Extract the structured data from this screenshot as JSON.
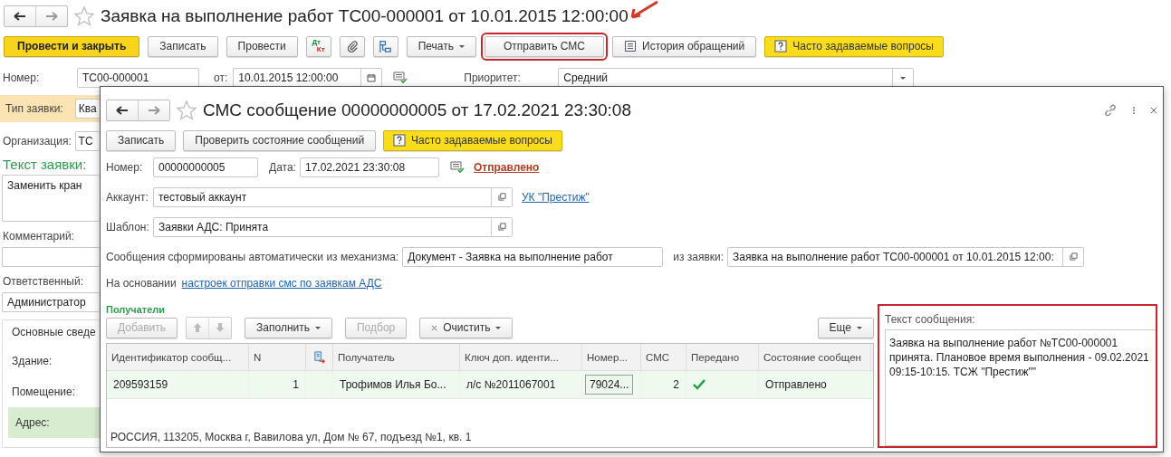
{
  "main_window": {
    "title": "Заявка на выполнение работ ТС00-000001 от 10.01.2015 12:00:00",
    "toolbar": [
      {
        "kind": "primary",
        "label": "Провести и закрыть",
        "highlighted": false
      },
      {
        "kind": "button",
        "label": "Записать",
        "highlighted": false
      },
      {
        "kind": "button",
        "label": "Провести",
        "highlighted": false
      },
      {
        "kind": "dtkt",
        "top": "Дт",
        "bottom": "Кт",
        "highlighted": false
      },
      {
        "kind": "clip",
        "highlighted": false
      },
      {
        "kind": "structure",
        "highlighted": false
      },
      {
        "kind": "dropdown",
        "label": "Печать",
        "highlighted": false
      },
      {
        "kind": "button",
        "label": "Отправить СМС",
        "highlighted": true
      },
      {
        "kind": "list",
        "label": "История обращений",
        "highlighted": false
      },
      {
        "kind": "help",
        "label": "Часто задаваемые вопросы",
        "highlighted": false
      }
    ],
    "number_label": "Номер:",
    "number": "ТС00-000001",
    "date_label": "от:",
    "date": "10.01.2015 12:00:00",
    "priority_label": "Приоритет:",
    "priority": "Средний",
    "type_label": "Тип заявки:",
    "type": "Ква",
    "org_label": "Организация:",
    "org": "ТС",
    "text_heading": "Текст заявки:",
    "text": "Заменить кран",
    "comment_label": "Комментарий:",
    "responsible_label": "Ответственный:",
    "responsible": "Администратор",
    "group_title": "Основные сведе",
    "building_label": "Здание:",
    "room_label": "Помещение:",
    "address_label": "Адрес:"
  },
  "sms_dialog": {
    "title": "СМС сообщение 00000000005 от 17.02.2021 23:30:08",
    "toolbar": [
      {
        "kind": "button",
        "label": "Записать"
      },
      {
        "kind": "button",
        "label": "Проверить состояние сообщений"
      },
      {
        "kind": "help",
        "label": "Часто задаваемые вопросы"
      }
    ],
    "number_label": "Номер:",
    "number": "00000000005",
    "date_label": "Дата:",
    "date": "17.02.2021 23:30:08",
    "status": "Отправлено",
    "account_label": "Аккаунт:",
    "account": "тестовый аккаунт",
    "account_link": "УК \"Престиж\"",
    "template_label": "Шаблон:",
    "template": "Заявки АДС: Принята",
    "source_label": "Сообщения сформированы автоматически из механизма:",
    "source": "Документ - Заявка на выполнение работ",
    "request_label": "из заявки:",
    "request": "Заявка на выполнение работ ТС00-000001 от 10.01.2015 12:00:",
    "basis_text": "На основании",
    "basis_link": "настроек отправки смс по заявкам АДС",
    "recipients_title": "Получатели",
    "recipients_toolbar": [
      {
        "kind": "button",
        "label": "Добавить",
        "disabled": true
      },
      {
        "kind": "arrows",
        "disabled": true
      },
      {
        "kind": "dropdown",
        "label": "Заполнить",
        "disabled": false
      },
      {
        "kind": "button",
        "label": "Подбор",
        "disabled": true
      },
      {
        "kind": "clear",
        "label": "Очистить",
        "disabled": false
      }
    ],
    "more_button": "Еще",
    "table": {
      "columns": [
        {
          "kind": "text",
          "label": "Идентификатор сообщ..."
        },
        {
          "kind": "text",
          "label": "N"
        },
        {
          "kind": "icon"
        },
        {
          "kind": "text",
          "label": "Получатель"
        },
        {
          "kind": "text",
          "label": "Ключ доп. иденти..."
        },
        {
          "kind": "text",
          "label": "Номер..."
        },
        {
          "kind": "text",
          "label": "СМС"
        },
        {
          "kind": "text",
          "label": "Передано"
        },
        {
          "kind": "text",
          "label": "Состояние сообщен"
        }
      ],
      "rows": [
        {
          "selected": true,
          "id": "209593159",
          "n": "1",
          "recipient": "Трофимов Илья Бо...",
          "key": "л/с №2011067001",
          "phone": "79024...",
          "sms": "2",
          "transmitted": true,
          "state": "Отправлено"
        }
      ],
      "address": "РОССИЯ, 113205, Москва г, Вавилова ул, Дом № 67, подъезд №1, кв. 1"
    },
    "message": {
      "label": "Текст сообщения:",
      "text": "Заявка на выполнение работ №ТС00-000001 принята. Плановое время выполнения - 09.02.2021 09:15-10:15. ТСЖ \"Престиж\"\"",
      "highlighted": true
    }
  }
}
